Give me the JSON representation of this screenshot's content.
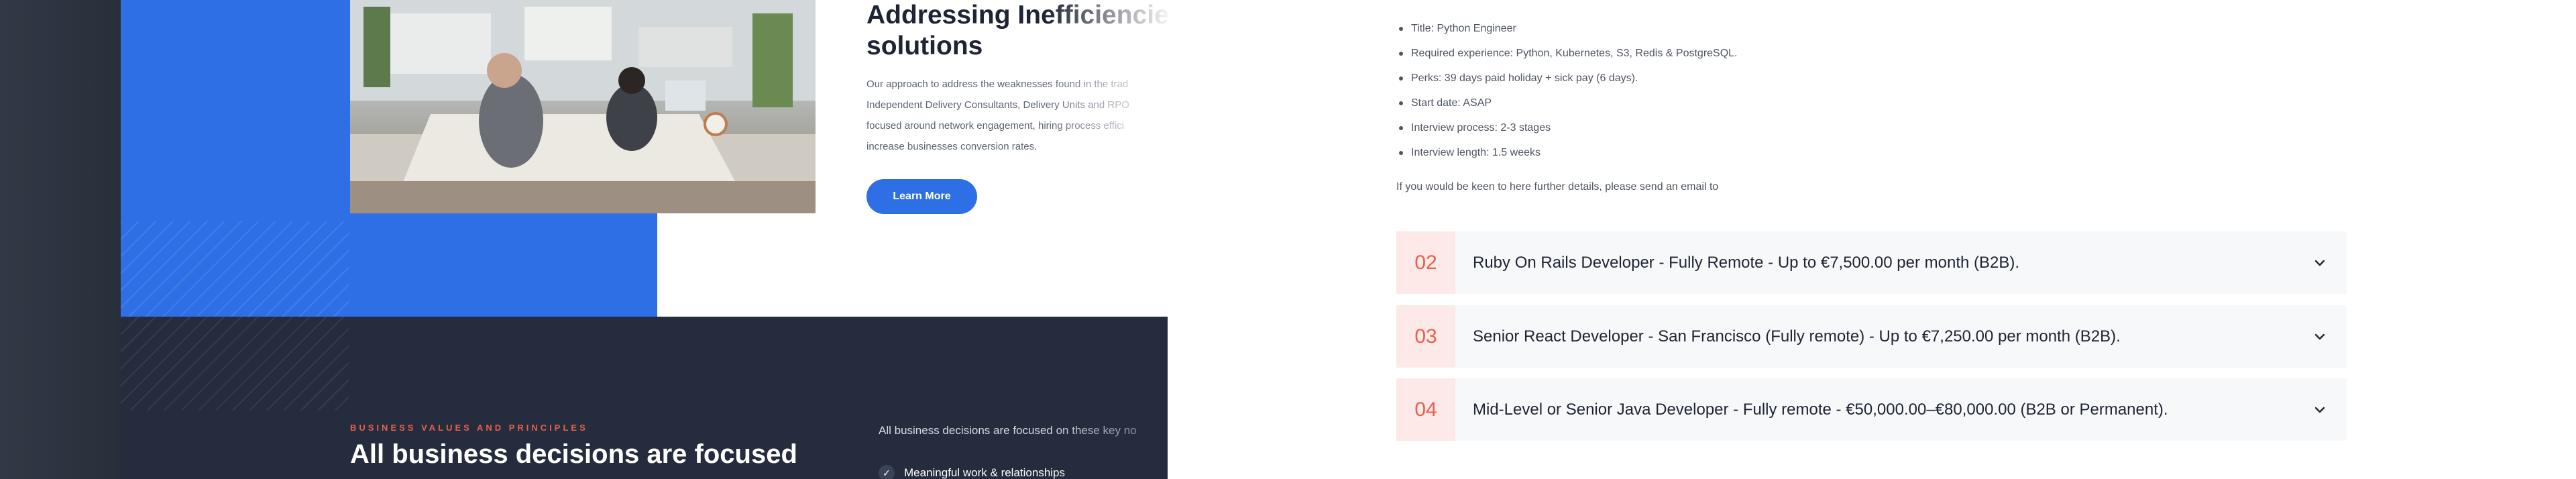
{
  "intro": {
    "title_line1": "Addressing Inefficiencies v",
    "title_line2": "solutions",
    "body_lines": [
      "Our approach to address the weaknesses found in the trad",
      "Independent Delivery Consultants, Delivery Units and RPO",
      "focused around network engagement, hiring process effici",
      "increase businesses conversion rates."
    ],
    "learn_more": "Learn More"
  },
  "values": {
    "eyebrow": "BUSINESS VALUES AND PRINCIPLES",
    "title": "All business decisions are focused",
    "intro": "All business decisions are focused on these key no",
    "check_item": "Meaningful work & relationships",
    "check_icon": "check-icon"
  },
  "job": {
    "bullets": [
      "Title: Python Engineer",
      "Required experience: Python, Kubernetes, S3, Redis & PostgreSQL.",
      "Perks: 39 days paid holiday + sick pay (6 days).",
      "Start date: ASAP",
      "Interview process: 2-3 stages",
      "Interview length: 1.5 weeks"
    ],
    "contact_note": "If you would be keen to here further details, please send an email to"
  },
  "accordion": [
    {
      "number": "02",
      "title": "Ruby On Rails Developer - Fully Remote - Up to €7,500.00 per month (B2B)."
    },
    {
      "number": "03",
      "title": "Senior React Developer - San Francisco (Fully remote) - Up to €7,250.00 per month (B2B)."
    },
    {
      "number": "04",
      "title": "Mid-Level or Senior Java Developer - Fully remote - €50,000.00–€80,000.00 (B2B or Permanent)."
    }
  ],
  "colors": {
    "brand_blue": "#2f6fe6",
    "dark_navy": "#242c3d",
    "accent_coral": "#e8604c",
    "number_bg": "#fde9e7"
  }
}
